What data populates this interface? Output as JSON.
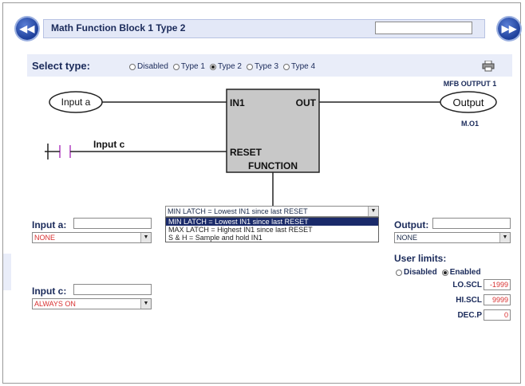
{
  "header": {
    "title": "Math Function Block 1 Type 2",
    "title_field_value": ""
  },
  "select_type": {
    "label": "Select type:",
    "options": [
      {
        "label": "Disabled",
        "selected": false
      },
      {
        "label": "Type 1",
        "selected": false
      },
      {
        "label": "Type 2",
        "selected": true
      },
      {
        "label": "Type 3",
        "selected": false
      },
      {
        "label": "Type 4",
        "selected": false
      }
    ]
  },
  "diagram": {
    "input_a": "Input a",
    "input_c": "Input c",
    "output": "Output",
    "output_name": "MFB OUTPUT 1",
    "output_address": "M.O1",
    "block_in1": "IN1",
    "block_out": "OUT",
    "block_reset": "RESET",
    "block_function": "FUNCTION"
  },
  "function_select": {
    "current": "MIN LATCH = Lowest IN1 since last RESET",
    "options": [
      {
        "label": "MIN LATCH = Lowest IN1 since last RESET",
        "highlighted": true
      },
      {
        "label": "MAX LATCH = Highest IN1 since last RESET",
        "highlighted": false
      },
      {
        "label": "S & H = Sample and hold IN1",
        "highlighted": false
      }
    ]
  },
  "input_a": {
    "label": "Input a:",
    "text_value": "",
    "source": "NONE"
  },
  "input_c": {
    "label": "Input c:",
    "text_value": "",
    "source": "ALWAYS ON"
  },
  "output": {
    "label": "Output:",
    "text_value": "",
    "destination": "NONE"
  },
  "user_limits": {
    "label": "User limits:",
    "disabled_label": "Disabled",
    "enabled_label": "Enabled",
    "enabled": true,
    "lo_scl_label": "LO.SCL",
    "lo_scl_value": "-1999",
    "hi_scl_label": "HI.SCL",
    "hi_scl_value": "9999",
    "dec_p_label": "DEC.P",
    "dec_p_value": "0"
  },
  "icons": {
    "prev": "rewind-icon",
    "next": "fast-forward-icon",
    "print": "printer-icon",
    "dropdown": "chevron-down-icon"
  },
  "colors": {
    "accent": "#1d3f9a",
    "panel": "#e9edf9",
    "block_fill": "#c8c8c8",
    "contact": "#b040c0",
    "value_red": "#d83030"
  }
}
